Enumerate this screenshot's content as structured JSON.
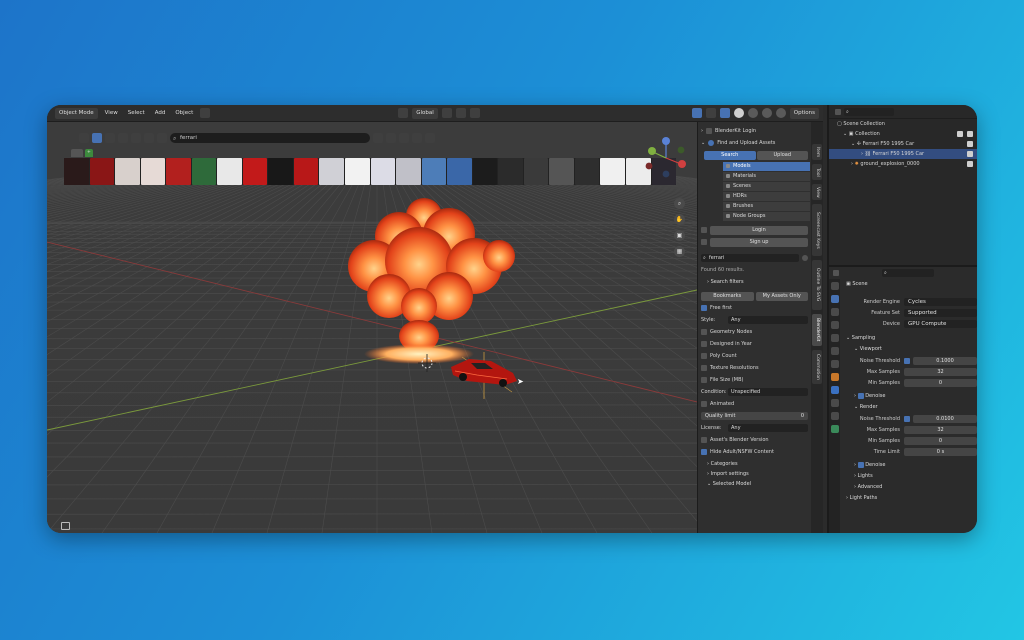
{
  "header": {
    "mode": "Object Mode",
    "menus": [
      "View",
      "Select",
      "Add",
      "Object"
    ],
    "transform": "Global",
    "options": "Options"
  },
  "strip": {
    "tab1": "",
    "search": "ferrari",
    "thumb_colors": [
      "#2a1a1a",
      "#8a1616",
      "#d8d0cc",
      "#e6dad6",
      "#b2201e",
      "#2e6a3a",
      "#e8e8e8",
      "#c21a1a",
      "#181818",
      "#b81818",
      "#d0d0d6",
      "#f2f2f2",
      "#dcdce6",
      "#c0c0c8",
      "#4d7db8",
      "#3a67a8",
      "#1c1c1c",
      "#2b2b2b",
      "#3a3a3a",
      "#555555",
      "#2e2e2e",
      "#f0f0f0",
      "#ececec",
      "#2b2830"
    ]
  },
  "panel": {
    "login": "BlenderKit Login",
    "find_upload": "Find and Upload Assets",
    "search_btn": "Search",
    "upload_btn": "Upload",
    "types": [
      "Models",
      "Materials",
      "Scenes",
      "HDRs",
      "Brushes",
      "Node Groups"
    ],
    "login_btn": "Login",
    "signup_btn": "Sign up",
    "search_value": "ferrari",
    "found": "Found 60 results.",
    "search_filters": "Search filters",
    "bookmarks": "Bookmarks",
    "my_assets": "My Assets Only",
    "free_first": "Free first",
    "style_label": "Style:",
    "style_value": "Any",
    "geometry_nodes": "Geometry Nodes",
    "designed_in_year": "Designed in Year",
    "poly_count": "Poly Count",
    "texture_resolutions": "Texture Resolutions",
    "file_size": "File Size (MB)",
    "condition_label": "Condition:",
    "condition_value": "Unspecified",
    "animated": "Animated",
    "quality_limit_label": "Quality limit",
    "quality_limit_value": "0",
    "license_label": "License:",
    "license_value": "Any",
    "assets_version": "Asset's Blender Version",
    "hide_adult": "Hide Adult/NSFW Content",
    "categories": "Categories",
    "import_settings": "Import settings",
    "selected_model": "Selected Model"
  },
  "vtabs": [
    "Item",
    "Tool",
    "View",
    "Screencast Keys",
    "Outline To SVG",
    "BlenderKit",
    "Commotion"
  ],
  "outliner": {
    "search_placeholder": "",
    "scene_collection": "Scene Collection",
    "collection": "Collection",
    "ferrari": "Ferrari F50 1995 Car",
    "ferrari_child": "Ferrari F50 1995 Car",
    "explosion": "ground_explosion_0000"
  },
  "props": {
    "search_placeholder": "",
    "scene": "Scene",
    "render_engine_label": "Render Engine",
    "render_engine": "Cycles",
    "feature_set_label": "Feature Set",
    "feature_set": "Supported",
    "device_label": "Device",
    "device": "GPU Compute",
    "sampling": "Sampling",
    "viewport": "Viewport",
    "noise_threshold_label": "Noise Threshold",
    "vp_noise_threshold": "0.1000",
    "max_samples_label": "Max Samples",
    "vp_max_samples": "32",
    "min_samples_label": "Min Samples",
    "vp_min_samples": "0",
    "denoise": "Denoise",
    "render": "Render",
    "r_noise_threshold": "0.0100",
    "r_max_samples": "32",
    "r_min_samples": "0",
    "time_limit_label": "Time Limit",
    "time_limit": "0 s",
    "lights": "Lights",
    "advanced": "Advanced",
    "light_paths": "Light Paths"
  }
}
